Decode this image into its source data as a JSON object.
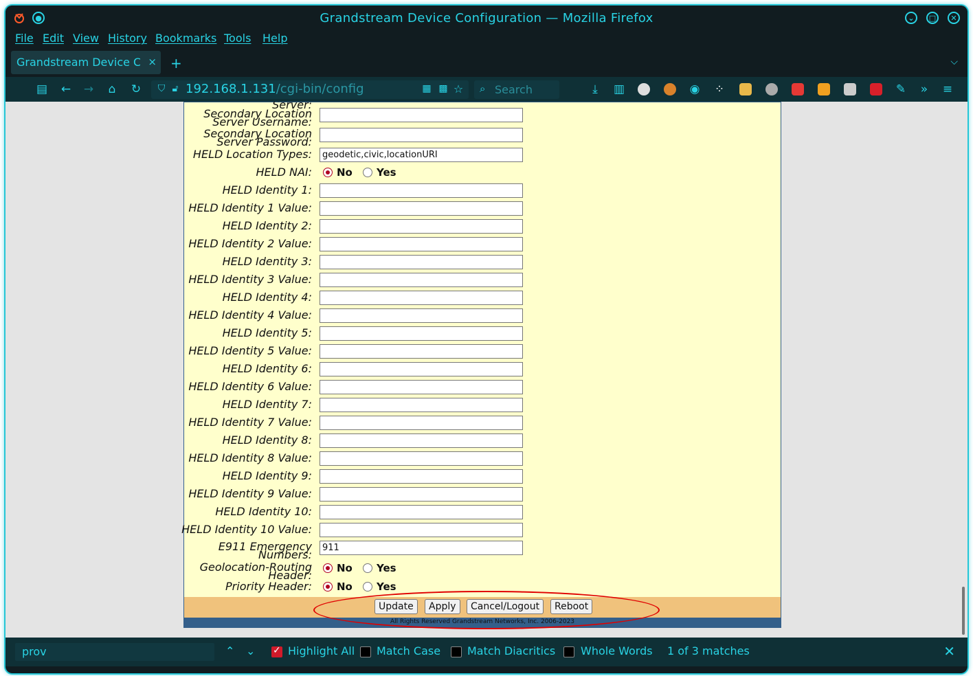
{
  "window": {
    "title": "Grandstream Device Configuration — Mozilla Firefox"
  },
  "menu": [
    "File",
    "Edit",
    "View",
    "History",
    "Bookmarks",
    "Tools",
    "Help"
  ],
  "tab": {
    "label": "Grandstream Device Con",
    "close": "×",
    "new": "+"
  },
  "url": {
    "host": "192.168.1.131",
    "path": "/cgi-bin/config"
  },
  "search": {
    "placeholder": "Search"
  },
  "form": {
    "partial_label": "Server:",
    "rows": [
      {
        "label1": "Secondary Location",
        "label2": "Server Username:",
        "value": ""
      },
      {
        "label1": "Secondary Location",
        "label2": "Server Password:",
        "value": ""
      },
      {
        "label": "HELD Location Types:",
        "value": "geodetic,civic,locationURI"
      },
      {
        "label": "HELD NAI:"
      },
      {
        "label": "HELD Identity 1:",
        "value": ""
      },
      {
        "label": "HELD Identity 1 Value:",
        "value": ""
      },
      {
        "label": "HELD Identity 2:",
        "value": ""
      },
      {
        "label": "HELD Identity 2 Value:",
        "value": ""
      },
      {
        "label": "HELD Identity 3:",
        "value": ""
      },
      {
        "label": "HELD Identity 3 Value:",
        "value": ""
      },
      {
        "label": "HELD Identity 4:",
        "value": ""
      },
      {
        "label": "HELD Identity 4 Value:",
        "value": ""
      },
      {
        "label": "HELD Identity 5:",
        "value": ""
      },
      {
        "label": "HELD Identity 5 Value:",
        "value": ""
      },
      {
        "label": "HELD Identity 6:",
        "value": ""
      },
      {
        "label": "HELD Identity 6 Value:",
        "value": ""
      },
      {
        "label": "HELD Identity 7:",
        "value": ""
      },
      {
        "label": "HELD Identity 7 Value:",
        "value": ""
      },
      {
        "label": "HELD Identity 8:",
        "value": ""
      },
      {
        "label": "HELD Identity 8 Value:",
        "value": ""
      },
      {
        "label": "HELD Identity 9:",
        "value": ""
      },
      {
        "label": "HELD Identity 9 Value:",
        "value": ""
      },
      {
        "label": "HELD Identity 10:",
        "value": ""
      },
      {
        "label": "HELD Identity 10 Value:",
        "value": ""
      },
      {
        "label1": "E911 Emergency",
        "label2": "Numbers:",
        "value": "911"
      },
      {
        "label1": "Geolocation-Routing",
        "label2": "Header:"
      },
      {
        "label": "Priority Header:"
      }
    ],
    "radio_no": "No",
    "radio_yes": "Yes",
    "buttons": {
      "update": "Update",
      "apply": "Apply",
      "cancel": "Cancel/Logout",
      "reboot": "Reboot"
    },
    "footer": "All Rights Reserved Grandstream Networks, Inc. 2006-2023"
  },
  "findbar": {
    "query": "prov",
    "highlight_all": "Highlight All",
    "match_case": "Match Case",
    "match_diacritics": "Match Diacritics",
    "whole_words": "Whole Words",
    "status": "1 of 3 matches"
  },
  "colors": {
    "accent": "#29d3e4",
    "page_bg": "#ffffcc",
    "button_bar": "#f0c27c",
    "annotation": "#e00000"
  }
}
